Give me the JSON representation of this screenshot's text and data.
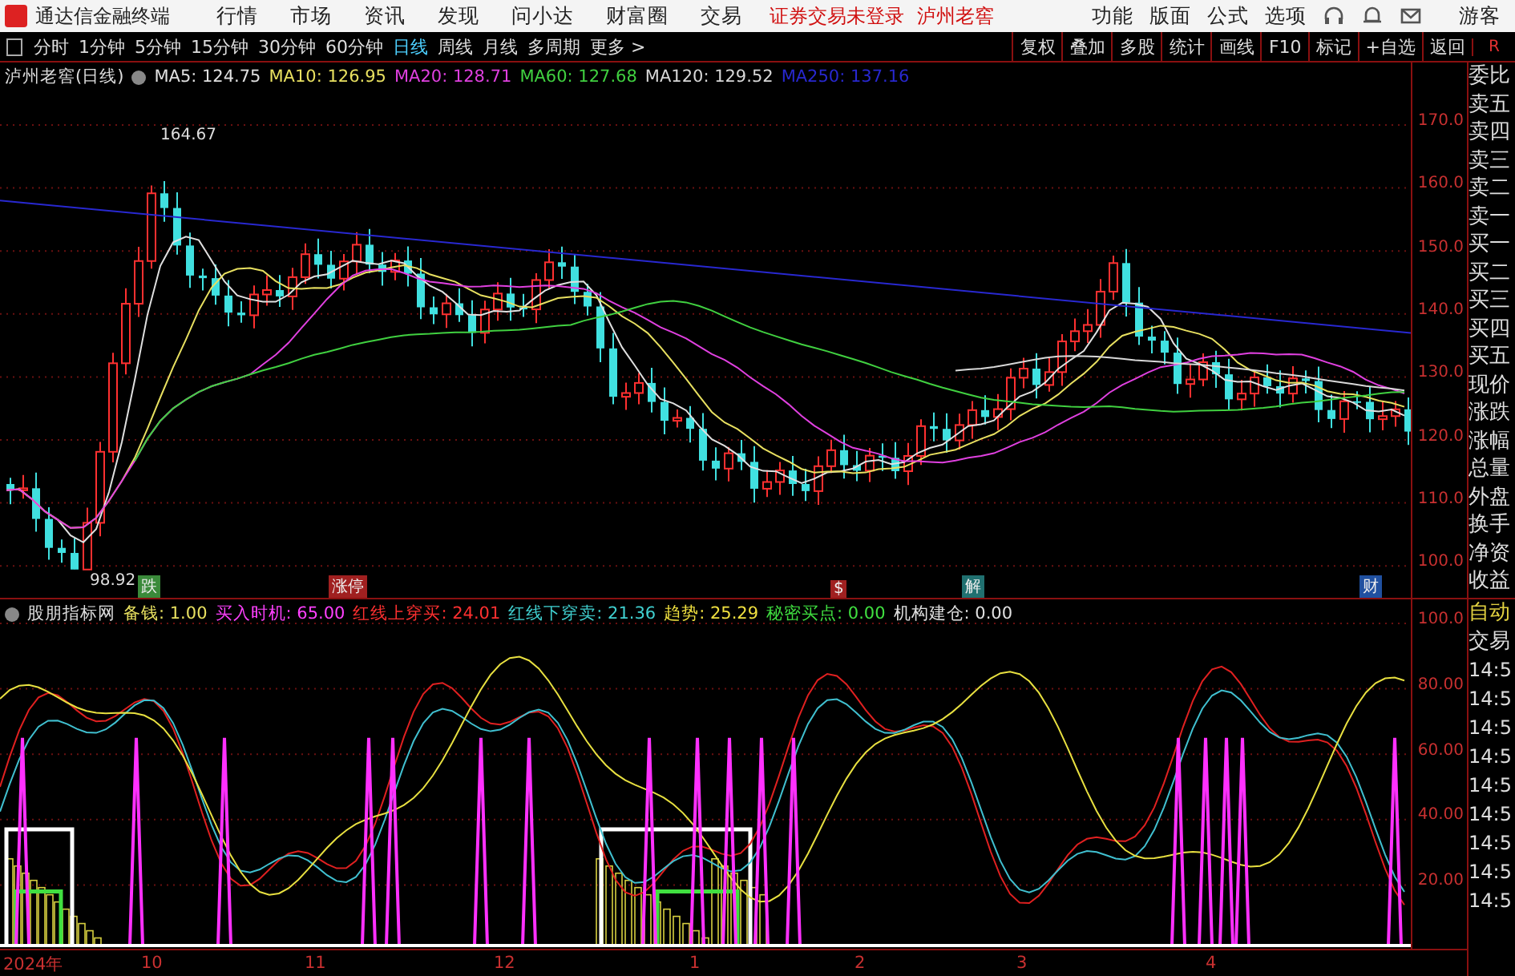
{
  "top_bar": {
    "app_title": "通达信金融终端",
    "menu": [
      "行情",
      "市场",
      "资讯",
      "发现",
      "问小达",
      "财富圈",
      "交易"
    ],
    "status": "证券交易未登录",
    "stock": "泸州老窖",
    "tools": [
      "功能",
      "版面",
      "公式",
      "选项"
    ],
    "user": "游客"
  },
  "toolbar": {
    "periods": [
      {
        "label": "分时",
        "selected": false
      },
      {
        "label": "1分钟",
        "selected": false
      },
      {
        "label": "5分钟",
        "selected": false
      },
      {
        "label": "15分钟",
        "selected": false
      },
      {
        "label": "30分钟",
        "selected": false
      },
      {
        "label": "60分钟",
        "selected": false
      },
      {
        "label": "日线",
        "selected": true
      },
      {
        "label": "周线",
        "selected": false
      },
      {
        "label": "月线",
        "selected": false
      },
      {
        "label": "多周期",
        "selected": false
      },
      {
        "label": "更多 >",
        "selected": false
      }
    ],
    "actions": [
      "复权",
      "叠加",
      "多股",
      "统计",
      "画线",
      "F10",
      "标记",
      "+自选",
      "返回"
    ]
  },
  "price_chart": {
    "title": "泸州老窖(日线)",
    "moving_averages": [
      {
        "label": "MA5: 124.75",
        "color": "#e0e0e0"
      },
      {
        "label": "MA10: 126.95",
        "color": "#e8e060"
      },
      {
        "label": "MA20: 128.71",
        "color": "#e040e0"
      },
      {
        "label": "MA60: 127.68",
        "color": "#40d040"
      },
      {
        "label": "MA120: 129.52",
        "color": "#d8d8d8"
      },
      {
        "label": "MA250: 137.16",
        "color": "#2828d0"
      }
    ],
    "high_marker": "164.67",
    "low_marker": "98.92",
    "events": [
      {
        "label": "跌",
        "color": "#3a8a3a"
      },
      {
        "label": "涨停",
        "color": "#a02020"
      },
      {
        "label": "$",
        "color": "#a02020"
      },
      {
        "label": "解",
        "color": "#207070"
      },
      {
        "label": "财",
        "color": "#2050a0"
      }
    ],
    "axis_labels": [
      "170.0",
      "160.0",
      "150.0",
      "140.0",
      "130.0",
      "120.0",
      "110.0",
      "100.0"
    ]
  },
  "indicator": {
    "title": "股朋指标网",
    "values": [
      {
        "label": "备钱: 1.00",
        "color": "#e8e060"
      },
      {
        "label": "买入时机: 65.00",
        "color": "#ff40ff"
      },
      {
        "label": "红线上穿买: 24.01",
        "color": "#ff3030"
      },
      {
        "label": "红线下穿卖: 21.36",
        "color": "#40d0d0"
      },
      {
        "label": "趋势: 25.29",
        "color": "#f0e040"
      },
      {
        "label": "秘密买点: 0.00",
        "color": "#40e040"
      },
      {
        "label": "机构建仓: 0.00",
        "color": "#e0e0e0"
      }
    ],
    "axis_labels": [
      "100.0",
      "80.00",
      "60.00",
      "40.00",
      "20.00"
    ]
  },
  "quote_panel": {
    "header": "R",
    "labels": [
      "委比",
      "卖五",
      "卖四",
      "卖三",
      "卖二",
      "卖一",
      "买一",
      "买二",
      "买三",
      "买四",
      "买五",
      "现价",
      "涨跌",
      "涨幅",
      "总量",
      "外盘",
      "换手",
      "净资",
      "收益"
    ]
  },
  "trade_panel": {
    "labels": [
      "自动",
      "交易"
    ],
    "times": [
      "14:5",
      "14:5",
      "14:5",
      "14:5",
      "14:5",
      "14:5",
      "14:5",
      "14:5",
      "14:5"
    ]
  },
  "time_axis": [
    "2024年",
    "10",
    "11",
    "12",
    "1",
    "2",
    "3",
    "4"
  ]
}
